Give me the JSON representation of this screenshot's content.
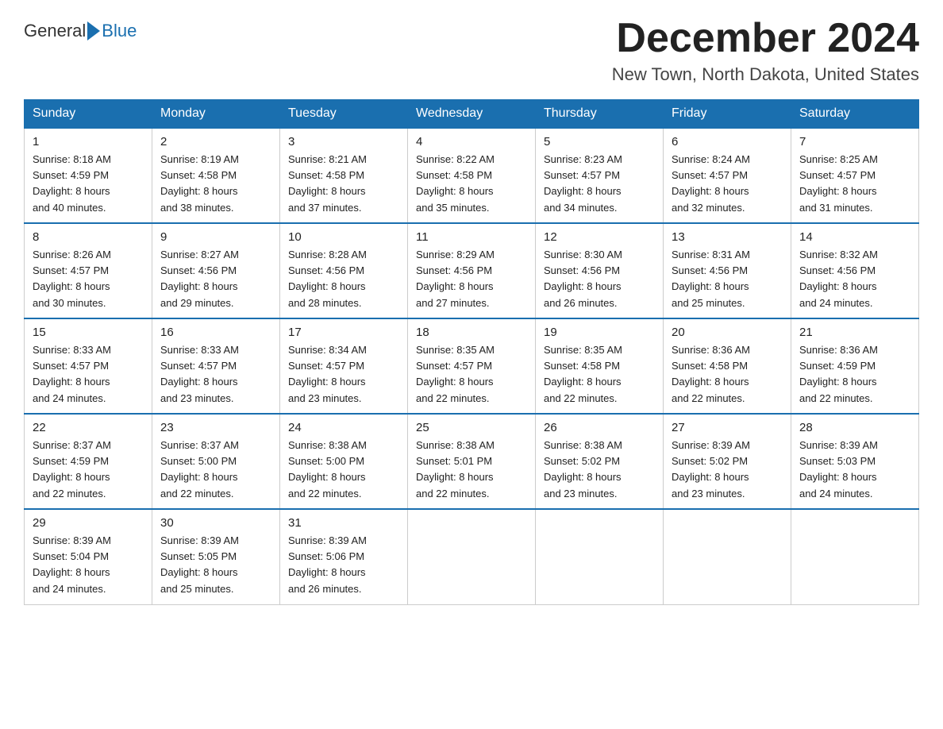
{
  "logo": {
    "general": "General",
    "blue": "Blue"
  },
  "title": "December 2024",
  "location": "New Town, North Dakota, United States",
  "days_of_week": [
    "Sunday",
    "Monday",
    "Tuesday",
    "Wednesday",
    "Thursday",
    "Friday",
    "Saturday"
  ],
  "weeks": [
    [
      {
        "day": "1",
        "sunrise": "8:18 AM",
        "sunset": "4:59 PM",
        "daylight": "8 hours and 40 minutes."
      },
      {
        "day": "2",
        "sunrise": "8:19 AM",
        "sunset": "4:58 PM",
        "daylight": "8 hours and 38 minutes."
      },
      {
        "day": "3",
        "sunrise": "8:21 AM",
        "sunset": "4:58 PM",
        "daylight": "8 hours and 37 minutes."
      },
      {
        "day": "4",
        "sunrise": "8:22 AM",
        "sunset": "4:58 PM",
        "daylight": "8 hours and 35 minutes."
      },
      {
        "day": "5",
        "sunrise": "8:23 AM",
        "sunset": "4:57 PM",
        "daylight": "8 hours and 34 minutes."
      },
      {
        "day": "6",
        "sunrise": "8:24 AM",
        "sunset": "4:57 PM",
        "daylight": "8 hours and 32 minutes."
      },
      {
        "day": "7",
        "sunrise": "8:25 AM",
        "sunset": "4:57 PM",
        "daylight": "8 hours and 31 minutes."
      }
    ],
    [
      {
        "day": "8",
        "sunrise": "8:26 AM",
        "sunset": "4:57 PM",
        "daylight": "8 hours and 30 minutes."
      },
      {
        "day": "9",
        "sunrise": "8:27 AM",
        "sunset": "4:56 PM",
        "daylight": "8 hours and 29 minutes."
      },
      {
        "day": "10",
        "sunrise": "8:28 AM",
        "sunset": "4:56 PM",
        "daylight": "8 hours and 28 minutes."
      },
      {
        "day": "11",
        "sunrise": "8:29 AM",
        "sunset": "4:56 PM",
        "daylight": "8 hours and 27 minutes."
      },
      {
        "day": "12",
        "sunrise": "8:30 AM",
        "sunset": "4:56 PM",
        "daylight": "8 hours and 26 minutes."
      },
      {
        "day": "13",
        "sunrise": "8:31 AM",
        "sunset": "4:56 PM",
        "daylight": "8 hours and 25 minutes."
      },
      {
        "day": "14",
        "sunrise": "8:32 AM",
        "sunset": "4:56 PM",
        "daylight": "8 hours and 24 minutes."
      }
    ],
    [
      {
        "day": "15",
        "sunrise": "8:33 AM",
        "sunset": "4:57 PM",
        "daylight": "8 hours and 24 minutes."
      },
      {
        "day": "16",
        "sunrise": "8:33 AM",
        "sunset": "4:57 PM",
        "daylight": "8 hours and 23 minutes."
      },
      {
        "day": "17",
        "sunrise": "8:34 AM",
        "sunset": "4:57 PM",
        "daylight": "8 hours and 23 minutes."
      },
      {
        "day": "18",
        "sunrise": "8:35 AM",
        "sunset": "4:57 PM",
        "daylight": "8 hours and 22 minutes."
      },
      {
        "day": "19",
        "sunrise": "8:35 AM",
        "sunset": "4:58 PM",
        "daylight": "8 hours and 22 minutes."
      },
      {
        "day": "20",
        "sunrise": "8:36 AM",
        "sunset": "4:58 PM",
        "daylight": "8 hours and 22 minutes."
      },
      {
        "day": "21",
        "sunrise": "8:36 AM",
        "sunset": "4:59 PM",
        "daylight": "8 hours and 22 minutes."
      }
    ],
    [
      {
        "day": "22",
        "sunrise": "8:37 AM",
        "sunset": "4:59 PM",
        "daylight": "8 hours and 22 minutes."
      },
      {
        "day": "23",
        "sunrise": "8:37 AM",
        "sunset": "5:00 PM",
        "daylight": "8 hours and 22 minutes."
      },
      {
        "day": "24",
        "sunrise": "8:38 AM",
        "sunset": "5:00 PM",
        "daylight": "8 hours and 22 minutes."
      },
      {
        "day": "25",
        "sunrise": "8:38 AM",
        "sunset": "5:01 PM",
        "daylight": "8 hours and 22 minutes."
      },
      {
        "day": "26",
        "sunrise": "8:38 AM",
        "sunset": "5:02 PM",
        "daylight": "8 hours and 23 minutes."
      },
      {
        "day": "27",
        "sunrise": "8:39 AM",
        "sunset": "5:02 PM",
        "daylight": "8 hours and 23 minutes."
      },
      {
        "day": "28",
        "sunrise": "8:39 AM",
        "sunset": "5:03 PM",
        "daylight": "8 hours and 24 minutes."
      }
    ],
    [
      {
        "day": "29",
        "sunrise": "8:39 AM",
        "sunset": "5:04 PM",
        "daylight": "8 hours and 24 minutes."
      },
      {
        "day": "30",
        "sunrise": "8:39 AM",
        "sunset": "5:05 PM",
        "daylight": "8 hours and 25 minutes."
      },
      {
        "day": "31",
        "sunrise": "8:39 AM",
        "sunset": "5:06 PM",
        "daylight": "8 hours and 26 minutes."
      },
      null,
      null,
      null,
      null
    ]
  ],
  "labels": {
    "sunrise": "Sunrise:",
    "sunset": "Sunset:",
    "daylight": "Daylight:"
  }
}
